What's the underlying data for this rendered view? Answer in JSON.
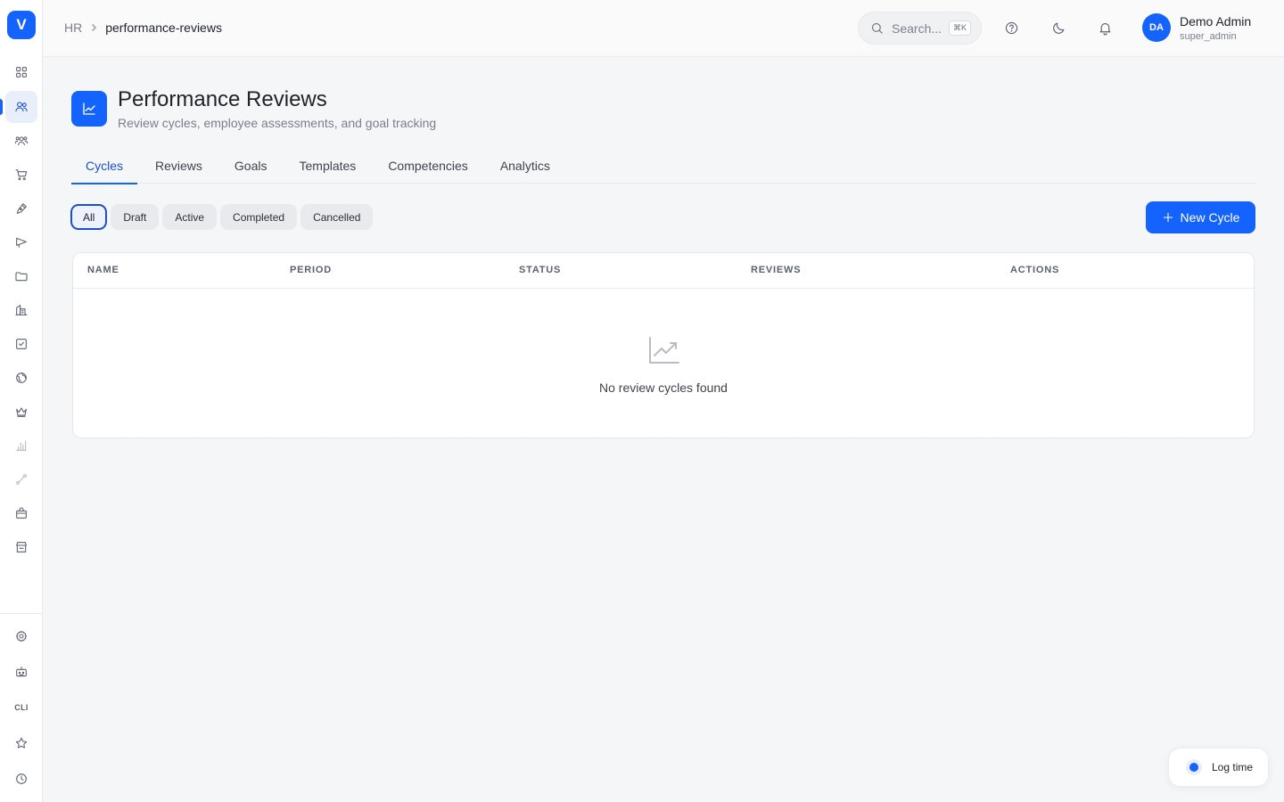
{
  "app": {
    "logo_letter": "V",
    "brand_color": "#1463ff"
  },
  "sidebar": {
    "items": [
      {
        "icon": "grid-icon",
        "active": false
      },
      {
        "icon": "users-icon",
        "active": true
      },
      {
        "icon": "team-icon",
        "active": false
      },
      {
        "icon": "cart-icon",
        "active": false
      },
      {
        "icon": "pen-icon",
        "active": false
      },
      {
        "icon": "megaphone-icon",
        "active": false
      },
      {
        "icon": "folder-icon",
        "active": false
      },
      {
        "icon": "building-icon",
        "active": false
      },
      {
        "icon": "checkbox-icon",
        "active": false
      },
      {
        "icon": "globe-icon",
        "active": false
      },
      {
        "icon": "crown-icon",
        "active": false
      },
      {
        "icon": "bar-chart-icon",
        "active": false
      },
      {
        "icon": "route-icon",
        "active": false
      },
      {
        "icon": "bag-icon",
        "active": false
      },
      {
        "icon": "store-icon",
        "active": false
      }
    ],
    "bottom_items": [
      {
        "icon": "gear-icon"
      },
      {
        "icon": "bot-icon"
      },
      {
        "icon": "cli-icon",
        "label": "CLI"
      },
      {
        "icon": "star-icon"
      },
      {
        "icon": "clock-icon"
      }
    ]
  },
  "header": {
    "breadcrumb_root": "HR",
    "breadcrumb_current": "performance-reviews",
    "search_placeholder": "Search...",
    "search_shortcut": "⌘K",
    "user_initials": "DA",
    "user_name": "Demo Admin",
    "user_role": "super_admin"
  },
  "page": {
    "title": "Performance Reviews",
    "subtitle": "Review cycles, employee assessments, and goal tracking",
    "tabs": [
      {
        "label": "Cycles",
        "active": true
      },
      {
        "label": "Reviews",
        "active": false
      },
      {
        "label": "Goals",
        "active": false
      },
      {
        "label": "Templates",
        "active": false
      },
      {
        "label": "Competencies",
        "active": false
      },
      {
        "label": "Analytics",
        "active": false
      }
    ],
    "filters": [
      {
        "label": "All",
        "active": true
      },
      {
        "label": "Draft",
        "active": false
      },
      {
        "label": "Active",
        "active": false
      },
      {
        "label": "Completed",
        "active": false
      },
      {
        "label": "Cancelled",
        "active": false
      }
    ],
    "new_button_label": "New Cycle"
  },
  "table": {
    "columns": [
      "NAME",
      "PERIOD",
      "STATUS",
      "REVIEWS",
      "ACTIONS"
    ],
    "rows": [],
    "empty_message": "No review cycles found"
  },
  "floating": {
    "log_time_label": "Log time"
  }
}
